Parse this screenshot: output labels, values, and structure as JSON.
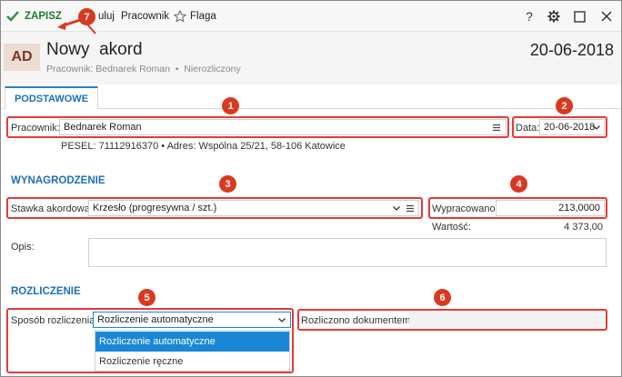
{
  "toolbar": {
    "save_label": "ZAPISZ",
    "cancel_label": "uluj",
    "employee_label": "Pracownik",
    "flag_label": "Flaga",
    "help_label": "?"
  },
  "header": {
    "avatar": "AD",
    "title": "Nowy  akord",
    "subtitle": "Pracownik: Bednarek Roman  •  Nierozliczony",
    "date": "20-06-2018"
  },
  "tabs": [
    {
      "label": "PODSTAWOWE"
    }
  ],
  "basic": {
    "employee_label": "Pracownik:",
    "employee_value": "Bednarek Roman",
    "date_label": "Data:",
    "date_value": "20-06-2018",
    "pesel_info": "PESEL:  71112916370  •  Adres:  Wspólna 25/21, 58-106 Katowice"
  },
  "salary": {
    "section_title": "WYNAGRODZENIE",
    "rate_label": "Stawka akordowa:",
    "rate_value": "Krzesło (progresywna / szt.)",
    "worked_label": "Wypracowano:",
    "worked_value": "213,0000",
    "value_label": "Wartość:",
    "value_value": "4 373,00",
    "desc_label": "Opis:"
  },
  "settlement": {
    "section_title": "ROZLICZENIE",
    "method_label": "Sposób rozliczenia:",
    "method_value": "Rozliczenie automatyczne",
    "options": [
      "Rozliczenie automatyczne",
      "Rozliczenie ręczne"
    ],
    "settled_doc_label": "Rozliczono dokumentem:"
  },
  "annotations": [
    "1",
    "2",
    "3",
    "4",
    "5",
    "6",
    "7"
  ],
  "colors": {
    "accent": "#1e6fb3",
    "annotation": "#e4393b",
    "save": "#1f7a2e",
    "selected": "#1a87d6"
  }
}
